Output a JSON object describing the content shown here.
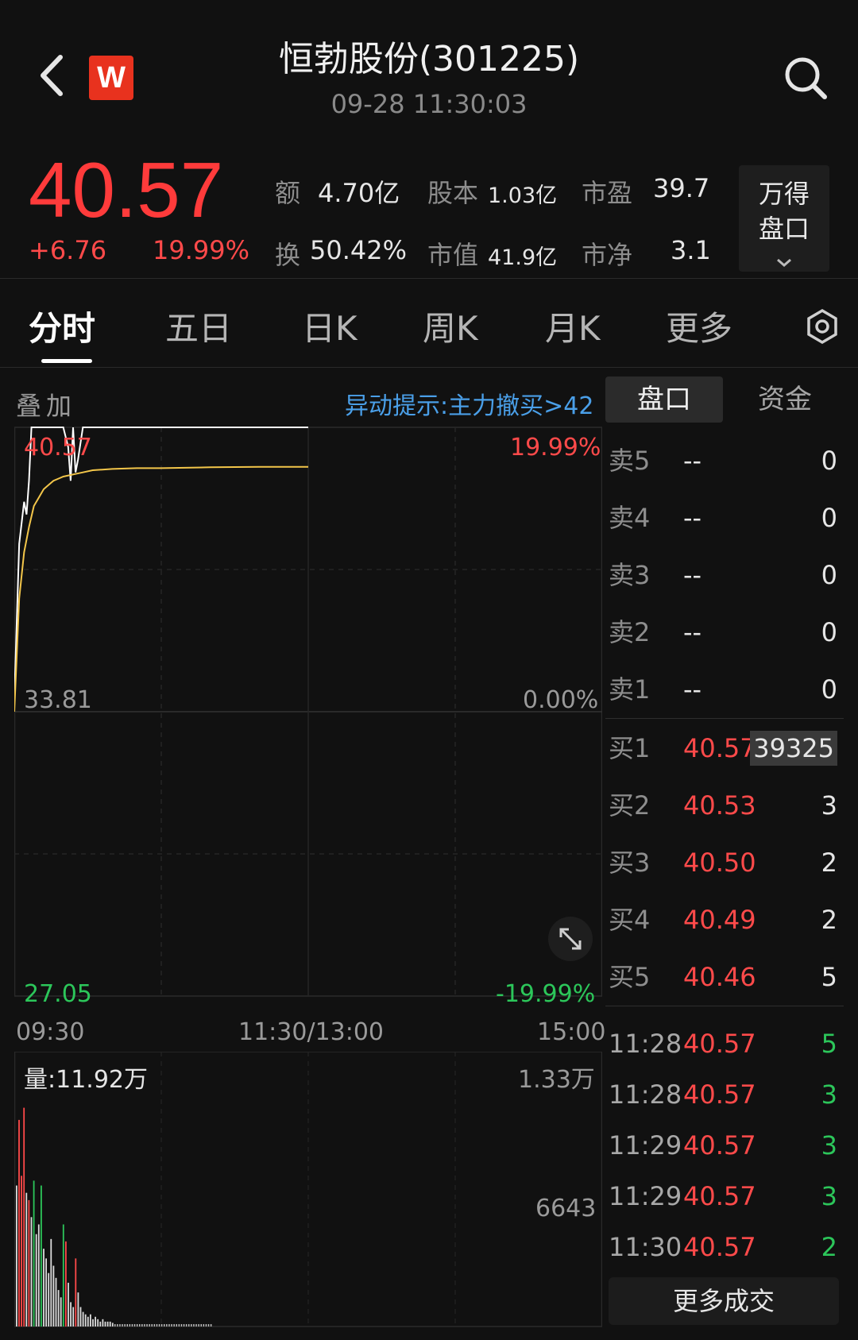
{
  "header": {
    "logo_text": "W",
    "title": "恒勃股份(301225)",
    "timestamp": "09-28 11:30:03"
  },
  "quote": {
    "price": "40.57",
    "change": "+6.76",
    "change_pct": "19.99%",
    "stats": {
      "amount_label": "额",
      "amount_value": "4.70亿",
      "capital_label": "股本",
      "capital_value": "1.03亿",
      "pe_label": "市盈",
      "pe_value": "39.7",
      "turnover_label": "换",
      "turnover_value": "50.42%",
      "mktcap_label": "市值",
      "mktcap_value": "41.9亿",
      "pb_label": "市净",
      "pb_value": "3.1"
    },
    "wind_pankou_label_1": "万得",
    "wind_pankou_label_2": "盘口"
  },
  "tabs": [
    "分时",
    "五日",
    "日K",
    "周K",
    "月K",
    "更多"
  ],
  "overlay": {
    "label": "叠加",
    "alert": "异动提示:主力撤买>42"
  },
  "panel_tabs": {
    "pankou": "盘口",
    "zijin": "资金"
  },
  "chart_labels": {
    "price_high": "40.57",
    "pct_high": "19.99%",
    "price_mid": "33.81",
    "pct_mid": "0.00%",
    "price_low": "27.05",
    "pct_low": "-19.99%",
    "time_start": "09:30",
    "time_mid": "11:30/13:00",
    "time_end": "15:00",
    "volume_label": "量:11.92万",
    "vol_max": "1.33万",
    "vol_mid": "6643"
  },
  "chart_data": {
    "type": "line",
    "ylim": [
      27.05,
      40.57
    ],
    "x_range_minutes": [
      0,
      240
    ],
    "series": [
      {
        "values_x": [
          0,
          2,
          4,
          5,
          6,
          7,
          8,
          9,
          10,
          11,
          12,
          14,
          20,
          22,
          23,
          24,
          25,
          26,
          28,
          29,
          30,
          120
        ],
        "values_y": [
          34.1,
          37.8,
          38.8,
          38.5,
          39.3,
          40.57,
          40.57,
          40.57,
          40.57,
          40.57,
          40.57,
          40.57,
          40.57,
          40.1,
          39.3,
          40.57,
          39.5,
          39.8,
          40.57,
          40.57,
          40.57,
          40.57
        ]
      },
      {
        "values_x": [
          0,
          2,
          4,
          6,
          8,
          10,
          12,
          14,
          16,
          18,
          20,
          24,
          28,
          32,
          40,
          50,
          60,
          80,
          100,
          120
        ],
        "values_y": [
          33.81,
          36.5,
          37.6,
          38.2,
          38.7,
          38.9,
          39.1,
          39.2,
          39.3,
          39.35,
          39.4,
          39.45,
          39.5,
          39.55,
          39.58,
          39.6,
          39.6,
          39.62,
          39.63,
          39.63
        ]
      }
    ],
    "volume_scale_max": 13300,
    "volume_bars": [
      {
        "v": 0.58,
        "c": "w"
      },
      {
        "v": 0.85,
        "c": "r"
      },
      {
        "v": 0.62,
        "c": "r"
      },
      {
        "v": 0.9,
        "c": "r"
      },
      {
        "v": 0.55,
        "c": "w"
      },
      {
        "v": 0.52,
        "c": "r"
      },
      {
        "v": 0.45,
        "c": "w"
      },
      {
        "v": 0.6,
        "c": "g"
      },
      {
        "v": 0.38,
        "c": "w"
      },
      {
        "v": 0.42,
        "c": "w"
      },
      {
        "v": 0.58,
        "c": "g"
      },
      {
        "v": 0.32,
        "c": "w"
      },
      {
        "v": 0.28,
        "c": "w"
      },
      {
        "v": 0.22,
        "c": "w"
      },
      {
        "v": 0.36,
        "c": "w"
      },
      {
        "v": 0.25,
        "c": "w"
      },
      {
        "v": 0.2,
        "c": "w"
      },
      {
        "v": 0.15,
        "c": "w"
      },
      {
        "v": 0.12,
        "c": "w"
      },
      {
        "v": 0.42,
        "c": "g"
      },
      {
        "v": 0.35,
        "c": "r"
      },
      {
        "v": 0.18,
        "c": "w"
      },
      {
        "v": 0.1,
        "c": "w"
      },
      {
        "v": 0.08,
        "c": "w"
      },
      {
        "v": 0.28,
        "c": "r"
      },
      {
        "v": 0.14,
        "c": "w"
      },
      {
        "v": 0.08,
        "c": "w"
      },
      {
        "v": 0.06,
        "c": "w"
      },
      {
        "v": 0.05,
        "c": "w"
      },
      {
        "v": 0.04,
        "c": "w"
      },
      {
        "v": 0.05,
        "c": "w"
      },
      {
        "v": 0.03,
        "c": "w"
      },
      {
        "v": 0.04,
        "c": "w"
      },
      {
        "v": 0.03,
        "c": "w"
      },
      {
        "v": 0.02,
        "c": "w"
      },
      {
        "v": 0.03,
        "c": "w"
      },
      {
        "v": 0.02,
        "c": "w"
      },
      {
        "v": 0.02,
        "c": "w"
      },
      {
        "v": 0.02,
        "c": "w"
      },
      {
        "v": 0.015,
        "c": "w"
      }
    ]
  },
  "order_book": {
    "asks": [
      {
        "label": "卖5",
        "price": "--",
        "volume": "0"
      },
      {
        "label": "卖4",
        "price": "--",
        "volume": "0"
      },
      {
        "label": "卖3",
        "price": "--",
        "volume": "0"
      },
      {
        "label": "卖2",
        "price": "--",
        "volume": "0"
      },
      {
        "label": "卖1",
        "price": "--",
        "volume": "0"
      }
    ],
    "bids": [
      {
        "label": "买1",
        "price": "40.57",
        "volume": "39325"
      },
      {
        "label": "买2",
        "price": "40.53",
        "volume": "3"
      },
      {
        "label": "买3",
        "price": "40.50",
        "volume": "2"
      },
      {
        "label": "买4",
        "price": "40.49",
        "volume": "2"
      },
      {
        "label": "买5",
        "price": "40.46",
        "volume": "5"
      }
    ]
  },
  "ticks": [
    {
      "time": "11:28",
      "price": "40.57",
      "volume": "5"
    },
    {
      "time": "11:28",
      "price": "40.57",
      "volume": "3"
    },
    {
      "time": "11:29",
      "price": "40.57",
      "volume": "3"
    },
    {
      "time": "11:29",
      "price": "40.57",
      "volume": "3"
    },
    {
      "time": "11:30",
      "price": "40.57",
      "volume": "2"
    }
  ],
  "more_trades_label": "更多成交",
  "colors": {
    "up": "#ff4a4a",
    "down": "#2cc65a",
    "price_line": "#ffffff",
    "avg_line": "#f3c64a",
    "alert": "#4a9fe8"
  }
}
